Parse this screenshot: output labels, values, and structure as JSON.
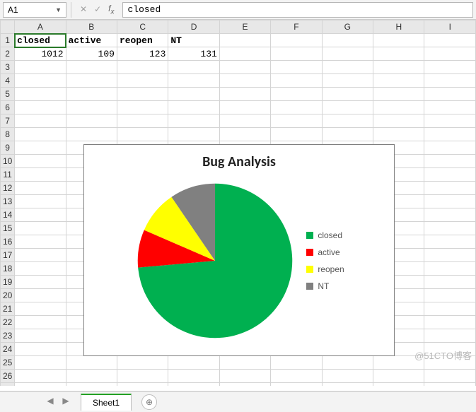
{
  "name_box": "A1",
  "formula_value": "closed",
  "columns": [
    "A",
    "B",
    "C",
    "D",
    "E",
    "F",
    "G",
    "H",
    "I"
  ],
  "rows": 27,
  "selected_cell": {
    "row": 1,
    "col": 0
  },
  "data_headers": [
    "closed",
    "active",
    "reopen",
    "NT"
  ],
  "data_values": [
    1012,
    109,
    123,
    131
  ],
  "chart_data": {
    "type": "pie",
    "title": "Bug Analysis",
    "series": [
      {
        "name": "closed",
        "value": 1012,
        "color": "#00b050"
      },
      {
        "name": "active",
        "value": 109,
        "color": "#ff0000"
      },
      {
        "name": "reopen",
        "value": 123,
        "color": "#ffff00"
      },
      {
        "name": "NT",
        "value": 131,
        "color": "#808080"
      }
    ]
  },
  "sheet_tab": "Sheet1",
  "watermark_br": "@51CTO博客"
}
